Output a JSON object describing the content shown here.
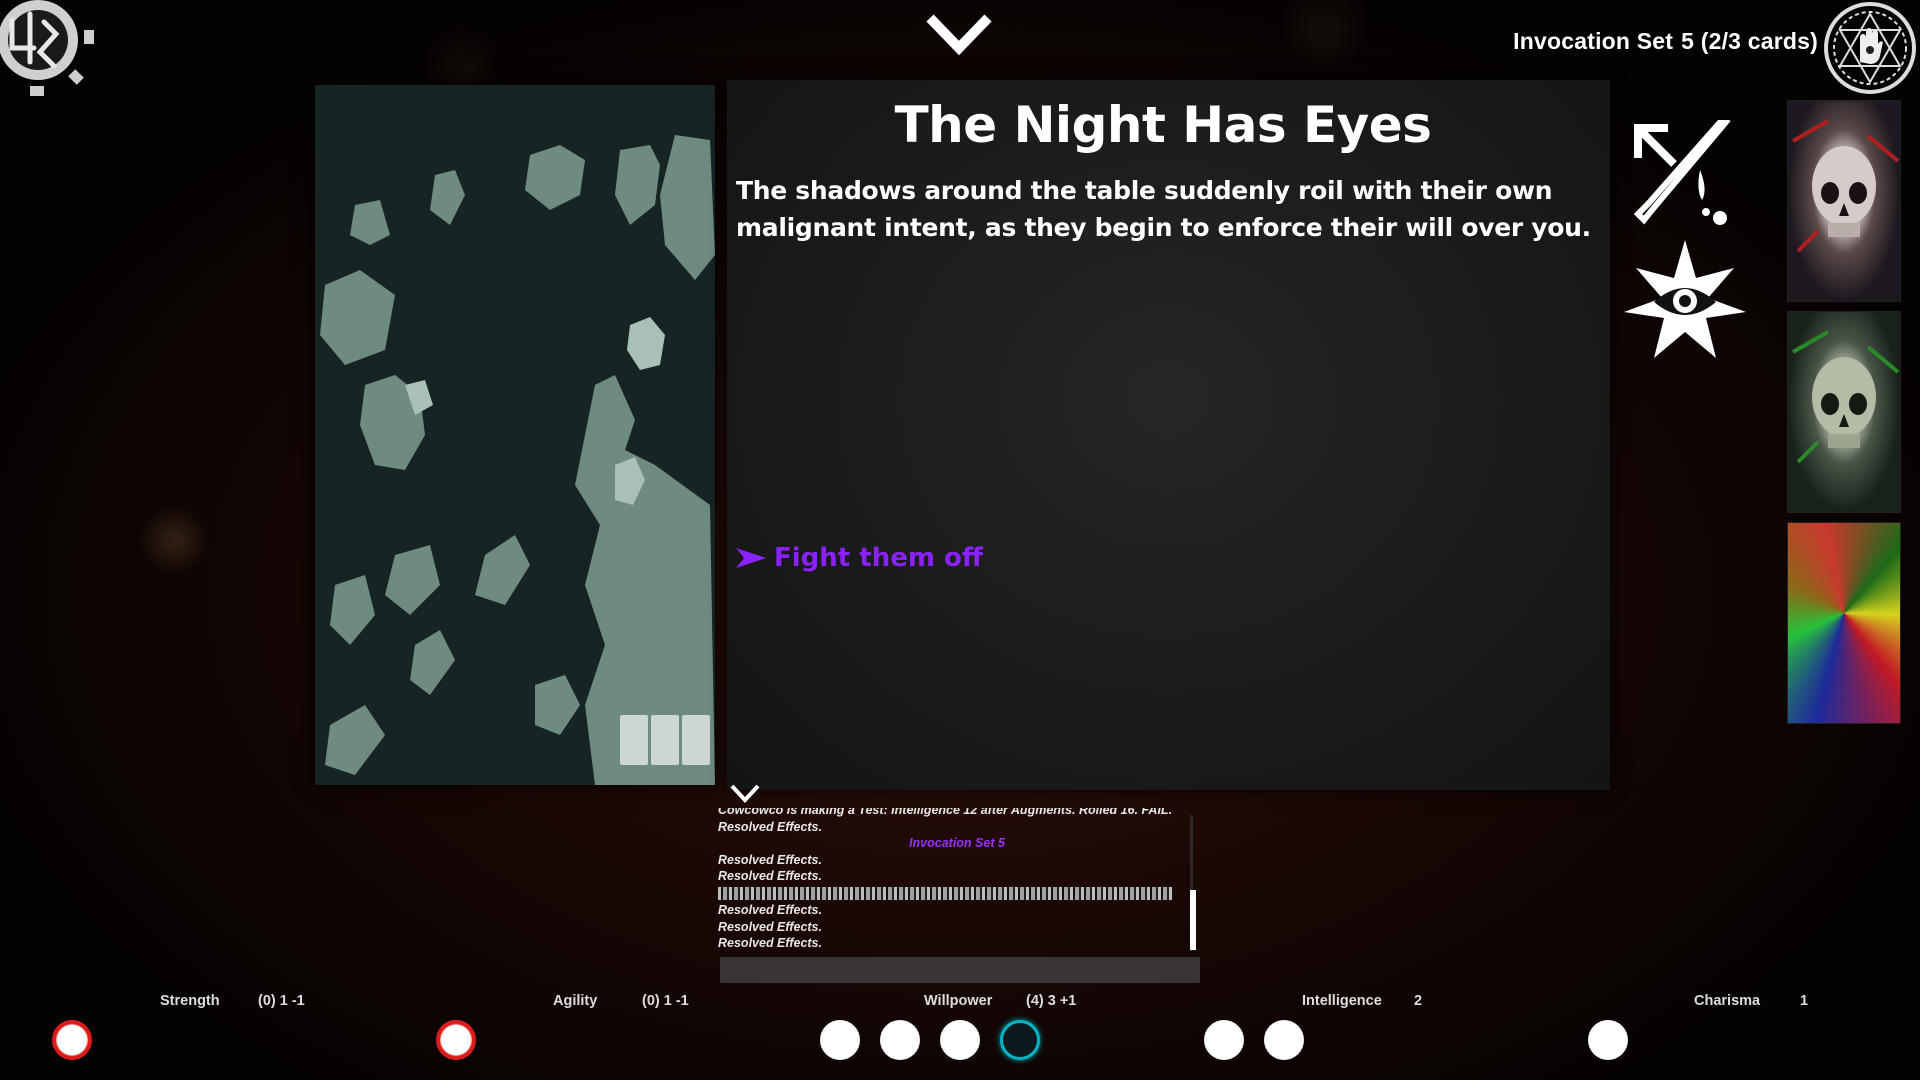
{
  "header": {
    "set_label": "Invocation Set",
    "set_value": "5 (2/3 cards)"
  },
  "card": {
    "title": "The Night Has Eyes",
    "body": "The shadows around the table suddenly roil with their own malignant intent, as they begin to enforce their will over you.",
    "choices": [
      {
        "label": "Fight them off"
      }
    ]
  },
  "log": {
    "lines": [
      {
        "text": "Cowcowco is making a Test: Intelligence 12 after Augments. Rolled 16. FAIL.",
        "style": "normal"
      },
      {
        "text": "Resolved Effects.",
        "style": "normal"
      },
      {
        "text": "Invocation Set 5",
        "style": "heading"
      },
      {
        "text": "Resolved Effects.",
        "style": "normal"
      },
      {
        "text": "Resolved Effects.",
        "style": "normal"
      },
      {
        "text": "",
        "style": "divider"
      },
      {
        "text": "Resolved Effects.",
        "style": "normal"
      },
      {
        "text": "Resolved Effects.",
        "style": "normal"
      },
      {
        "text": "Resolved Effects.",
        "style": "normal"
      }
    ]
  },
  "stats": [
    {
      "name": "Strength",
      "value": "(0) 1 -1",
      "pips": 1
    },
    {
      "name": "Agility",
      "value": "(0) 1 -1",
      "pips": 1
    },
    {
      "name": "Willpower",
      "value": "(4) 3 +1",
      "pips": 4
    },
    {
      "name": "Intelligence",
      "value": "2",
      "pips": 2
    },
    {
      "name": "Charisma",
      "value": "1",
      "pips": 1
    }
  ],
  "colors": {
    "choice": "#8a22ff",
    "log_heading": "#9a30ff",
    "pip_negative": "#e01a1a",
    "pip_bonus": "#00b4c4"
  },
  "icons": [
    "cthulhu-gear-logo-icon",
    "chevron-down-icon",
    "hand-seal-icon",
    "attack-dagger-icon",
    "eye-burst-icon",
    "deck-cards-icon"
  ]
}
